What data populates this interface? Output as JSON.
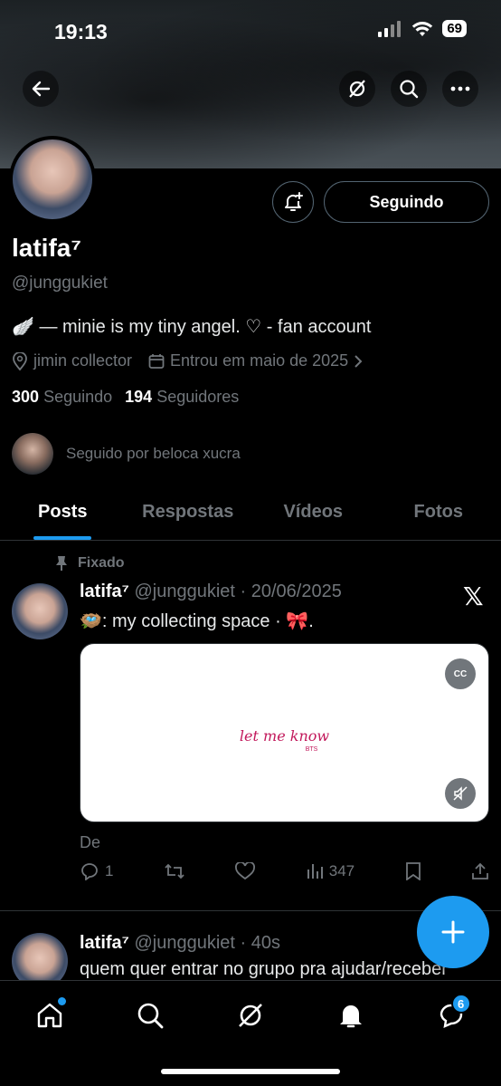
{
  "status_bar": {
    "time": "19:13",
    "battery": "69"
  },
  "profile": {
    "name": "latifa⁷",
    "handle": "@junggukiet",
    "follow_label": "Seguindo",
    "bio": "🪽 — minie is my tiny angel. ♡ - fan account",
    "location": "jimin collector",
    "joined": "Entrou em maio de 2025",
    "following_count": "300",
    "following_label": "Seguindo",
    "followers_count": "194",
    "followers_label": "Seguidores",
    "followed_by": "Seguido por beloca xucra"
  },
  "tabs": [
    "Posts",
    "Respostas",
    "Vídeos",
    "Fotos"
  ],
  "posts": [
    {
      "pinned_label": "Fixado",
      "name": "latifa⁷",
      "handle_date": "@junggukiet · 20/06/2025",
      "text": "🪺: my collecting space · 🎀.",
      "media_title": "let me know",
      "media_sub": "BTS",
      "cc": "CC",
      "caption": "De",
      "replies": "1",
      "views": "347"
    },
    {
      "name": "latifa⁷",
      "handle_date": "@junggukiet · 40s",
      "text": "quem quer entrar no grupo pra ajudar/receber"
    }
  ],
  "nav": {
    "messages_badge": "6"
  },
  "colors": {
    "accent": "#1d9bf0",
    "muted": "#71767b",
    "border": "#2f3336"
  }
}
